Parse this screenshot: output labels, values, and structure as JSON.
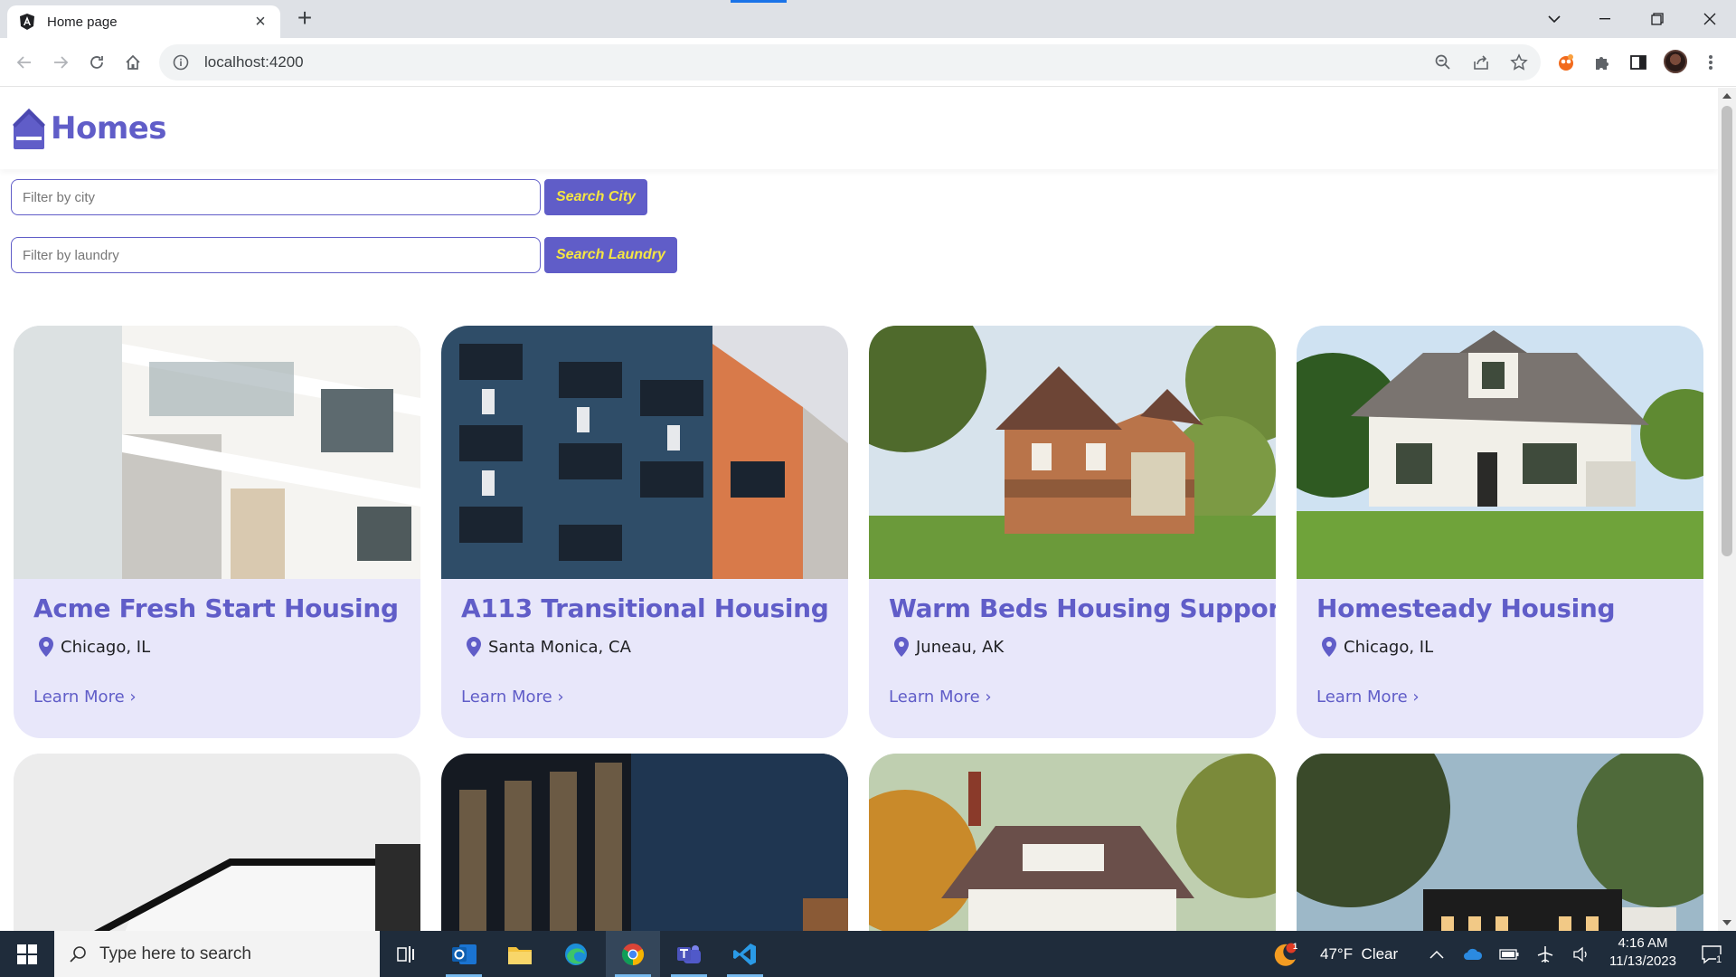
{
  "browser": {
    "tab_title": "Home page",
    "url": "localhost:4200"
  },
  "app": {
    "brand": "Homes",
    "filters": [
      {
        "placeholder": "Filter by city",
        "button": "Search City"
      },
      {
        "placeholder": "Filter by laundry",
        "button": "Search Laundry"
      }
    ],
    "cards": [
      {
        "title": "Acme Fresh Start Housing",
        "location": "Chicago, IL",
        "link": "Learn More ›"
      },
      {
        "title": "A113 Transitional Housing",
        "location": "Santa Monica, CA",
        "link": "Learn More ›"
      },
      {
        "title": "Warm Beds Housing Support",
        "location": "Juneau, AK",
        "link": "Learn More ›"
      },
      {
        "title": "Homesteady Housing",
        "location": "Chicago, IL",
        "link": "Learn More ›"
      }
    ]
  },
  "taskbar": {
    "search_placeholder": "Type here to search",
    "weather": "47°F  Clear",
    "weather_badge": "1",
    "time": "4:16 AM",
    "date": "11/13/2023",
    "notification_count": "1"
  },
  "colors": {
    "accent": "#605dc8",
    "card_bg": "#e8e7fa",
    "button_text": "#f5e642"
  }
}
